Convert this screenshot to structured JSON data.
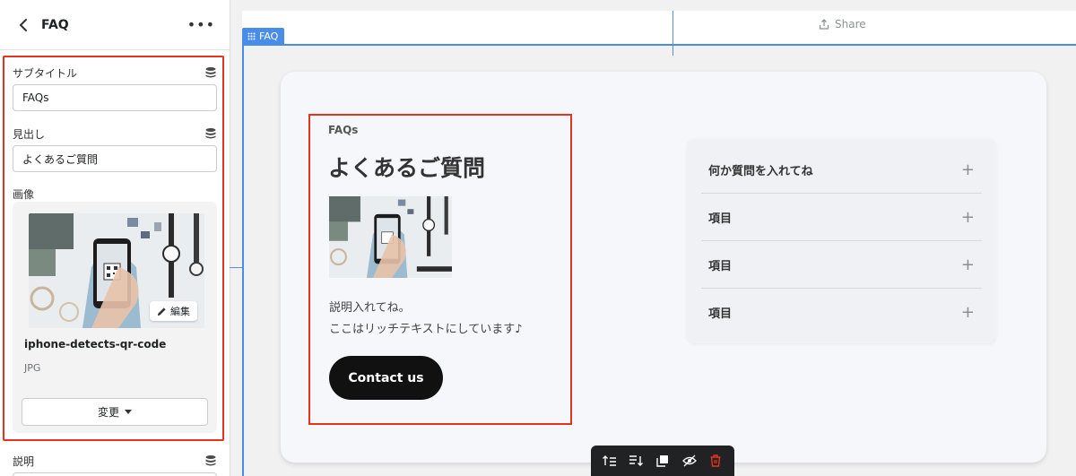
{
  "sidebar": {
    "title": "FAQ",
    "subtitle_label": "サブタイトル",
    "subtitle_value": "FAQs",
    "heading_label": "見出し",
    "heading_value": "よくあるご質問",
    "image_label": "画像",
    "image_edit_label": "編集",
    "image_filename": "iphone-detects-qr-code",
    "image_type": "JPG",
    "change_label": "変更",
    "description_label": "説明"
  },
  "canvas": {
    "share_label": "Share",
    "section_tag": "FAQ"
  },
  "section": {
    "subtitle": "FAQs",
    "heading": "よくあるご質問",
    "description_line1": "説明入れてね。",
    "description_line2": "ここはリッチテキストにしています♪",
    "cta_label": "Contact us",
    "faq_items": [
      "何か質問を入れてね",
      "項目",
      "項目",
      "項目"
    ]
  },
  "toolbar": {
    "items": [
      "move-up-icon",
      "move-down-icon",
      "duplicate-icon",
      "hide-icon",
      "delete-icon"
    ]
  },
  "colors": {
    "highlight_red": "#e3341d",
    "selection_blue": "#4a8de8",
    "cta_bg": "#111111"
  }
}
